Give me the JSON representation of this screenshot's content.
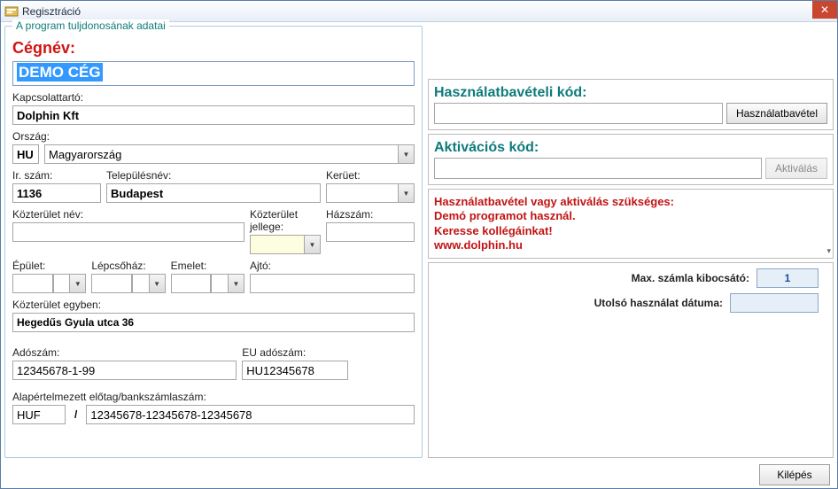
{
  "window": {
    "title": "Regisztráció",
    "close_icon": "✕"
  },
  "left": {
    "legend": "A program tuljdonosának adatai",
    "company_label": "Cégnév:",
    "company_value": "DEMO CÉG",
    "contact_label": "Kapcsolattartó:",
    "contact_value": "Dolphin Kft",
    "country_label": "Ország:",
    "country_code": "HU",
    "country_name": "Magyarország",
    "zip_label": "Ir. szám:",
    "zip_value": "1136",
    "city_label": "Településnév:",
    "city_value": "Budapest",
    "district_label": "Kerüet:",
    "district_value": "",
    "street_label": "Közterület név:",
    "street_value": "",
    "street_type_label": "Közterület jellege:",
    "street_type_value": "",
    "house_label": "Házszám:",
    "house_value": "",
    "building_label": "Épület:",
    "stair_label": "Lépcsőház:",
    "floor_label": "Emelet:",
    "door_label": "Ajtó:",
    "fulladdr_label": "Közterület egyben:",
    "fulladdr_value": "Hegedűs Gyula utca 36",
    "tax_label": "Adószám:",
    "tax_value": "12345678-1-99",
    "eutax_label": "EU adószám:",
    "eutax_value": "HU12345678",
    "bank_label": "Alapértelmezett előtag/bankszámlaszám:",
    "bank_prefix": "HUF",
    "bank_value": "12345678-12345678-12345678"
  },
  "right": {
    "usage_code_label": "Használatbavételi kód:",
    "usage_button": "Használatbavétel",
    "activation_label": "Aktivációs kód:",
    "activation_button": "Aktiválás",
    "warn_line1": "Használatbavétel vagy aktiválás szükséges:",
    "warn_line2": "Demó programot használ.",
    "warn_line3": "Keresse kollégáinkat!",
    "warn_line4": "www.dolphin.hu",
    "max_issuer_label": "Max. számla kibocsátó:",
    "max_issuer_value": "1",
    "last_use_label": "Utolsó használat dátuma:",
    "last_use_value": ""
  },
  "footer": {
    "exit": "Kilépés"
  }
}
